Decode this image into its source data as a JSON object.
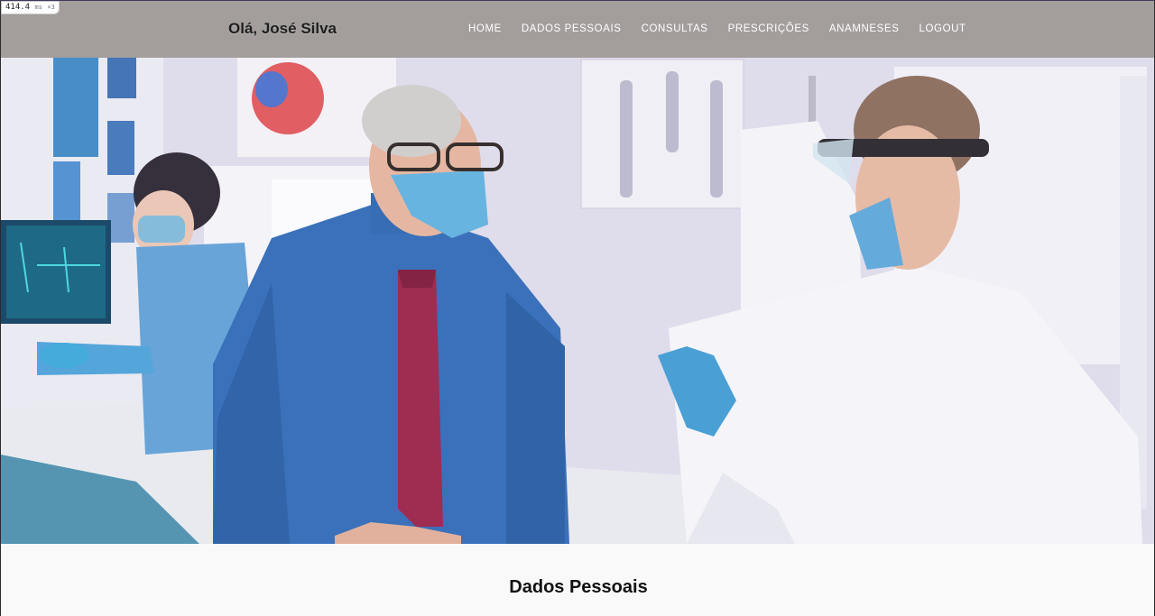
{
  "timing": {
    "value": "414.4",
    "unit": "ms",
    "multiplier": "×3"
  },
  "header": {
    "greeting": "Olá, José Silva",
    "nav": [
      "HOME",
      "DADOS PESSOAIS",
      "CONSULTAS",
      "PRESCRIÇÕES",
      "ANAMNESES",
      "LOGOUT"
    ]
  },
  "hero": {
    "image": "photo: clinic consultation with masked patient, doctor and nurse"
  },
  "main": {
    "section_title": "Dados Pessoais"
  },
  "colors": {
    "navbar": "#a39e9c",
    "nav_text": "#ffffff",
    "brand_text": "#1e1e1e",
    "page_bg": "#f9f9f9"
  }
}
